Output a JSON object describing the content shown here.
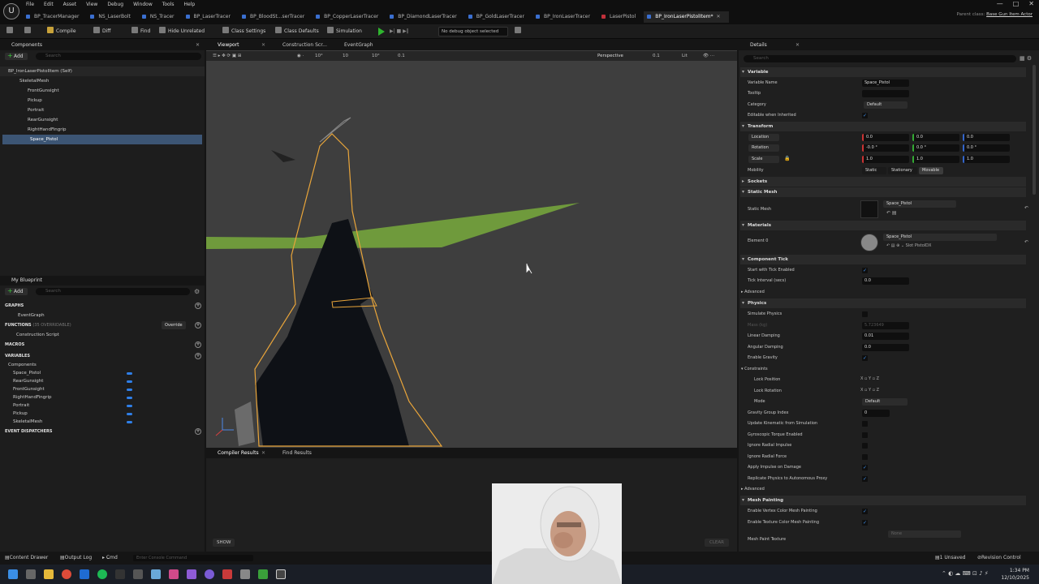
{
  "menu": [
    "File",
    "Edit",
    "Asset",
    "View",
    "Debug",
    "Window",
    "Tools",
    "Help"
  ],
  "logo": "U",
  "tabs": [
    {
      "label": "BP_TracerManager",
      "active": false
    },
    {
      "label": "NS_LaserBolt",
      "active": false
    },
    {
      "label": "NS_Tracer",
      "active": false
    },
    {
      "label": "BP_LaserTracer",
      "active": false
    },
    {
      "label": "BP_BloodSt...serTracer",
      "active": false
    },
    {
      "label": "BP_CopperLaserTracer",
      "active": false
    },
    {
      "label": "BP_DiamondLaserTracer",
      "active": false
    },
    {
      "label": "BP_GoldLaserTracer",
      "active": false
    },
    {
      "label": "BP_IronLaserTracer",
      "active": false
    },
    {
      "label": "LaserPistol",
      "active": false
    },
    {
      "label": "BP_IronLaserPistolItem*",
      "active": true
    }
  ],
  "parent_class": {
    "label": "Parent class:",
    "value": "Base Gun Item Actor"
  },
  "window_controls": [
    "—",
    "□",
    "✕"
  ],
  "toolbar": {
    "compile": "Compile",
    "diff": "Diff",
    "find": "Find",
    "hide_unrelated": "Hide Unrelated",
    "class_settings": "Class Settings",
    "class_defaults": "Class Defaults",
    "simulation": "Simulation",
    "debug_object": "No debug object selected"
  },
  "components_panel": {
    "title": "Components",
    "add": "Add",
    "search_placeholder": "Search",
    "items": [
      {
        "label": "BP_IronLaserPistolItem (Self)",
        "level": 0,
        "selected": false
      },
      {
        "label": "SkeletalMesh",
        "level": 1,
        "selected": false
      },
      {
        "label": "FrontGunsight",
        "level": 2,
        "selected": false
      },
      {
        "label": "Pickup",
        "level": 2,
        "selected": false
      },
      {
        "label": "Portrait",
        "level": 2,
        "selected": false
      },
      {
        "label": "RearGunsight",
        "level": 2,
        "selected": false
      },
      {
        "label": "RightHandFingrip",
        "level": 2,
        "selected": false
      },
      {
        "label": "Space_Pistol",
        "level": 2,
        "selected": true
      }
    ]
  },
  "my_blueprint": {
    "title": "My Blueprint",
    "add": "Add",
    "search_placeholder": "Search",
    "graphs_label": "GRAPHS",
    "event_graph": "EventGraph",
    "functions_label": "FUNCTIONS",
    "functions_count": "(35 OVERRIDABLE)",
    "override": "Override",
    "construction_script": "Construction Script",
    "macros_label": "MACROS",
    "variables_label": "VARIABLES",
    "components_label": "Components",
    "variables": [
      "Space_Pistol",
      "RearGunsight",
      "FrontGunsight",
      "RightHandFingrip",
      "Portrait",
      "Pickup",
      "SkeletalMesh"
    ],
    "event_dispatchers_label": "EVENT DISPATCHERS"
  },
  "viewport": {
    "tabs": [
      "Viewport",
      "Construction Scr...",
      "EventGraph"
    ],
    "perspective": "Perspective",
    "lit": "Lit",
    "fov": "0.1",
    "grid": "10°",
    "snap": "10",
    "scale": "0.1"
  },
  "bottom": {
    "tabs": [
      "Compiler Results",
      "Find Results"
    ],
    "show": "SHOW",
    "clear": "CLEAR"
  },
  "details": {
    "title": "Details",
    "search_placeholder": "Search",
    "variable_section": "Variable",
    "variable_name_label": "Variable Name",
    "variable_name": "Space_Pistol",
    "tooltip_label": "Tooltip",
    "category_label": "Category",
    "category": "Default",
    "editable_inherited_label": "Editable when Inherited",
    "transform_section": "Transform",
    "location_label": "Location",
    "location": [
      "0.0",
      "0.0",
      "0.0"
    ],
    "rotation_label": "Rotation",
    "rotation": [
      "-0.0 °",
      "0.0 °",
      "0.0 °"
    ],
    "scale_label": "Scale",
    "scale": [
      "1.0",
      "1.0",
      "1.0"
    ],
    "mobility_label": "Mobility",
    "mobility_options": [
      "Static",
      "Stationary",
      "Movable"
    ],
    "sockets_section": "Sockets",
    "static_mesh_section": "Static Mesh",
    "static_mesh_label": "Static Mesh",
    "static_mesh": "Space_Pistol",
    "materials_section": "Materials",
    "element0_label": "Element 0",
    "element0": "Space_Pistol",
    "slot_label": "Slot",
    "slot": "PistolDX",
    "component_tick_section": "Component Tick",
    "start_tick_label": "Start with Tick Enabled",
    "tick_interval_label": "Tick Interval (secs)",
    "tick_interval": "0.0",
    "advanced_label": "Advanced",
    "physics_section": "Physics",
    "simulate_physics_label": "Simulate Physics",
    "mass_label": "Mass (kg)",
    "mass": "5.723649",
    "linear_damping_label": "Linear Damping",
    "linear_damping": "0.01",
    "angular_damping_label": "Angular Damping",
    "angular_damping": "0.0",
    "enable_gravity_label": "Enable Gravity",
    "constraints_label": "Constraints",
    "lock_position_label": "Lock Position",
    "lock_rotation_label": "Lock Rotation",
    "axes": [
      "X",
      "Y",
      "Z"
    ],
    "mode_label": "Mode",
    "mode": "Default",
    "gravity_group_label": "Gravity Group Index",
    "gravity_group": "0",
    "update_kinematic_label": "Update Kinematic from Simulation",
    "gyroscopic_label": "Gyroscopic Torque Enabled",
    "ignore_radial_impulse_label": "Ignore Radial Impulse",
    "ignore_radial_force_label": "Ignore Radial Force",
    "apply_impulse_label": "Apply Impulse on Damage",
    "replicate_physics_label": "Replicate Physics to Autonomous Proxy",
    "advanced2_label": "Advanced",
    "mesh_painting_section": "Mesh Painting",
    "vertex_color_label": "Enable Vertex Color Mesh Painting",
    "texture_color_label": "Enable Texture Color Mesh Painting",
    "mesh_paint_texture_label": "Mesh Paint Texture",
    "mesh_paint_texture": "None"
  },
  "statusbar": {
    "content_drawer": "Content Drawer",
    "output_log": "Output Log",
    "cmd": "Cmd",
    "console_placeholder": "Enter Console Command",
    "unsaved": "1 Unsaved",
    "revision": "Revision Control"
  },
  "clock": {
    "time": "1:34 PM",
    "date": "12/10/2025"
  }
}
